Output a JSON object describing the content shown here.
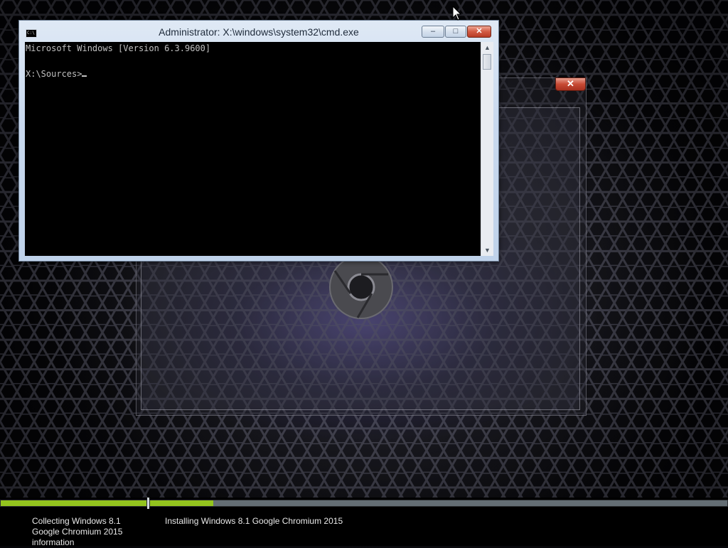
{
  "cmd": {
    "title": "Administrator: X:\\windows\\system32\\cmd.exe",
    "icon": "cmd-icon",
    "icon_text": "C:\\",
    "controls": {
      "minimize": "–",
      "maximize": "□",
      "close": "✕"
    },
    "lines": [
      "Microsoft Windows [Version 6.3.9600]",
      "",
      "X:\\Sources>"
    ]
  },
  "setup": {
    "close_label": "✕",
    "logo": "chromium-logo-icon"
  },
  "progress": {
    "steps": [
      {
        "label": "Collecting Windows 8.1 Google Chromium 2015 information",
        "fraction": 1.0
      },
      {
        "label": "Installing Windows 8.1 Google Chromium 2015",
        "fraction": 0.11
      }
    ],
    "fill_color": "#93c41e"
  }
}
